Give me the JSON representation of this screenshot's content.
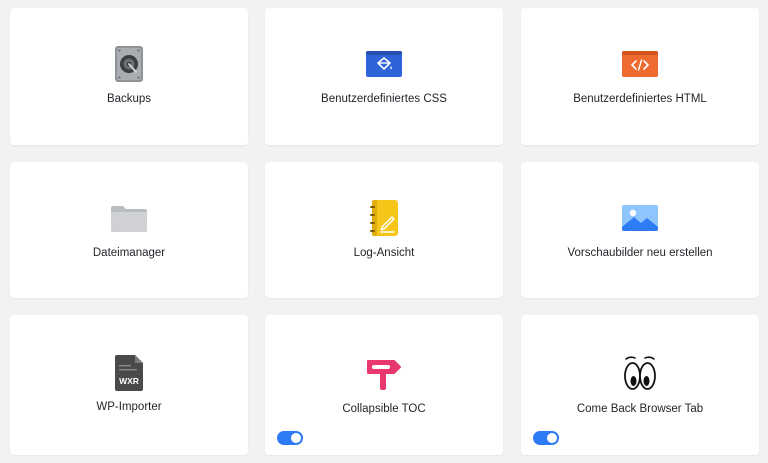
{
  "colors": {
    "toggle_on": "#2f7bf5",
    "css_icon": "#2f63d8",
    "html_icon": "#ee6a2f",
    "folder_icon": "#c9cbcf",
    "log_icon": "#f5c518",
    "image_icon": "#3d8cf0",
    "wxr_icon": "#4a4a4a",
    "toc_icon": "#e8386d"
  },
  "cards": [
    {
      "label": "Backups",
      "icon": "hard-drive-icon"
    },
    {
      "label": "Benutzerdefiniertes CSS",
      "icon": "paint-bucket-icon"
    },
    {
      "label": "Benutzerdefiniertes HTML",
      "icon": "code-window-icon"
    },
    {
      "label": "Dateimanager",
      "icon": "folder-icon"
    },
    {
      "label": "Log-Ansicht",
      "icon": "notebook-icon"
    },
    {
      "label": "Vorschaubilder neu erstellen",
      "icon": "image-icon"
    },
    {
      "label": "WP-Importer",
      "icon": "wxr-file-icon",
      "icon_text": "WXR"
    },
    {
      "label": "Collapsible TOC",
      "icon": "signpost-icon",
      "toggle": true
    },
    {
      "label": "Come Back Browser Tab",
      "icon": "eyes-icon",
      "toggle": true
    }
  ]
}
